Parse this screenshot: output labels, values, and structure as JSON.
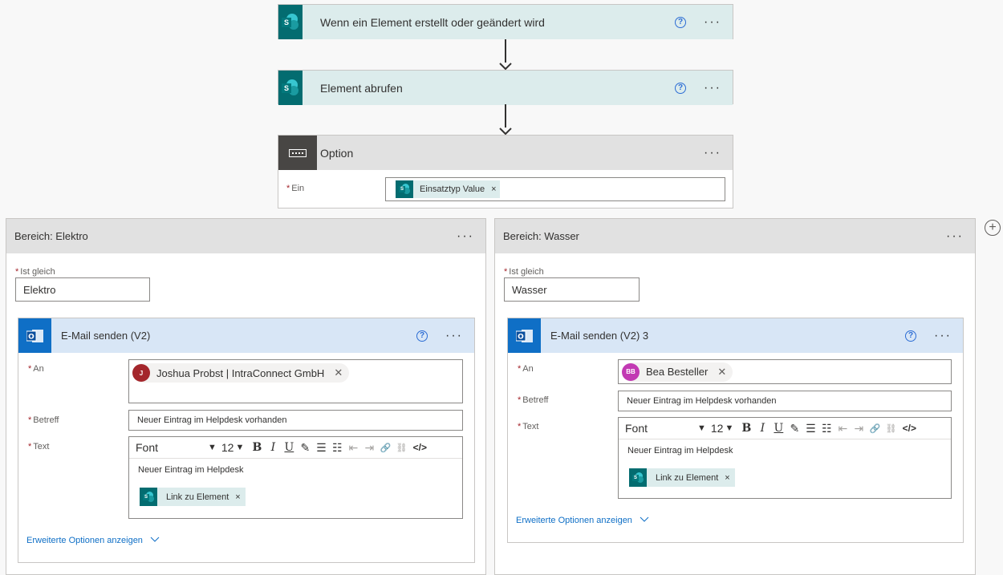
{
  "trigger": {
    "title": "Wenn ein Element erstellt oder geändert wird",
    "help": "?",
    "more": "···"
  },
  "get_item": {
    "title": "Element abrufen",
    "help": "?",
    "more": "···"
  },
  "switch": {
    "title": "Option",
    "more": "···",
    "on_label": "Ein",
    "on_token": "Einsatztyp Value",
    "token_remove": "×"
  },
  "add_case": "+",
  "cases": [
    {
      "title": "Bereich: Elektro",
      "more": "···",
      "equals_label": "Ist gleich",
      "equals_value": "Elektro",
      "mail": {
        "title": "E-Mail senden (V2)",
        "help": "?",
        "more": "···",
        "to_label": "An",
        "recipient": "Joshua Probst | IntraConnect GmbH",
        "recipient_initials": "J",
        "recipient_color": "#a4262c",
        "recipient_remove": "✕",
        "subject_label": "Betreff",
        "subject_value": "Neuer Eintrag im Helpdesk vorhanden",
        "text_label": "Text",
        "font": "Font",
        "size": "12",
        "body_text": "Neuer Eintrag im Helpdesk",
        "link_token": "Link zu Element",
        "token_remove": "×",
        "advanced": "Erweiterte Optionen anzeigen"
      }
    },
    {
      "title": "Bereich: Wasser",
      "more": "···",
      "equals_label": "Ist gleich",
      "equals_value": "Wasser",
      "mail": {
        "title": "E-Mail senden (V2) 3",
        "help": "?",
        "more": "···",
        "to_label": "An",
        "recipient": "Bea Besteller",
        "recipient_initials": "BB",
        "recipient_color": "#c239b3",
        "recipient_remove": "✕",
        "subject_label": "Betreff",
        "subject_value": "Neuer Eintrag im Helpdesk vorhanden",
        "text_label": "Text",
        "font": "Font",
        "size": "12",
        "body_text": "Neuer Eintrag im Helpdesk",
        "link_token": "Link zu Element",
        "token_remove": "×",
        "advanced": "Erweiterte Optionen anzeigen"
      }
    }
  ],
  "toolbar_glyphs": {
    "caret": "▼",
    "bold": "B",
    "italic": "I",
    "underline": "U",
    "highlight": "✎",
    "bullets": "☰",
    "numbers": "☷",
    "outdent": "⇤",
    "indent": "⇥",
    "link": "🔗",
    "unlink": "⛓",
    "code": "</>"
  },
  "colors": {
    "sharepoint": "#036c70",
    "outlook": "#0f6fc6",
    "required": "#a4262c",
    "link": "#0f6fc6"
  }
}
